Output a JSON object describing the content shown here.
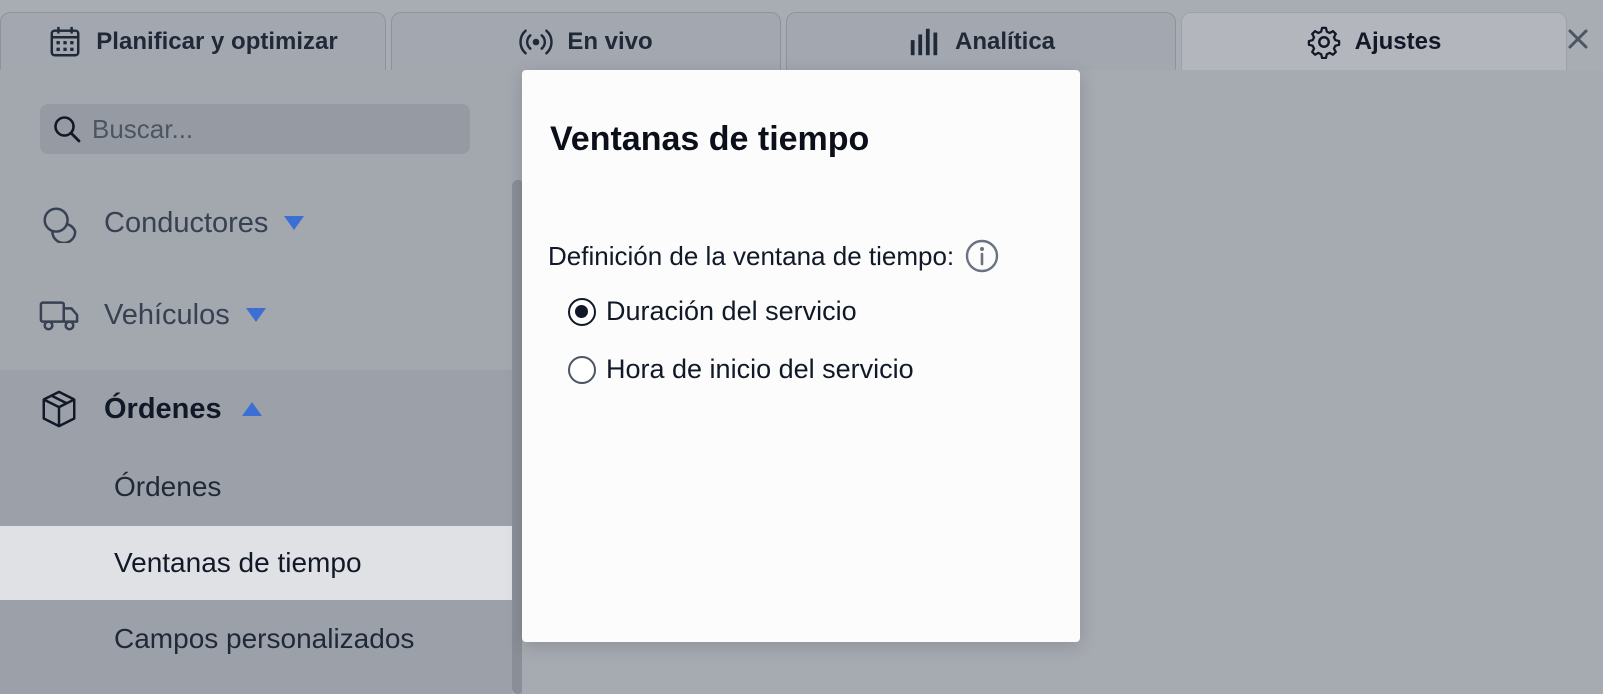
{
  "tabs": [
    {
      "label": "Planificar y optimizar",
      "icon": "calendar-icon"
    },
    {
      "label": "En vivo",
      "icon": "broadcast-icon"
    },
    {
      "label": "Analítica",
      "icon": "bar-chart-icon"
    },
    {
      "label": "Ajustes",
      "icon": "gear-icon",
      "active": true
    }
  ],
  "close_icon": "close-icon",
  "sidebar": {
    "search": {
      "placeholder": "Buscar...",
      "value": ""
    },
    "items": [
      {
        "label": "Conductores",
        "icon": "drivers-icon",
        "expanded": false
      },
      {
        "label": "Vehículos",
        "icon": "truck-icon",
        "expanded": false
      },
      {
        "label": "Órdenes",
        "icon": "package-icon",
        "expanded": true
      }
    ],
    "subitems": [
      {
        "label": "Órdenes",
        "selected": false
      },
      {
        "label": "Ventanas de tiempo",
        "selected": true
      },
      {
        "label": "Campos personalizados",
        "selected": false
      }
    ]
  },
  "modal": {
    "title": "Ventanas de tiempo",
    "field_label": "Definición de la ventana de tiempo:",
    "options": [
      {
        "label": "Duración del servicio",
        "checked": true
      },
      {
        "label": "Hora de inicio del servicio",
        "checked": false
      }
    ]
  },
  "colors": {
    "accent": "#3b6fd4",
    "selected_bg": "#dfe1e4",
    "modal_bg": "#fcfcfc"
  }
}
